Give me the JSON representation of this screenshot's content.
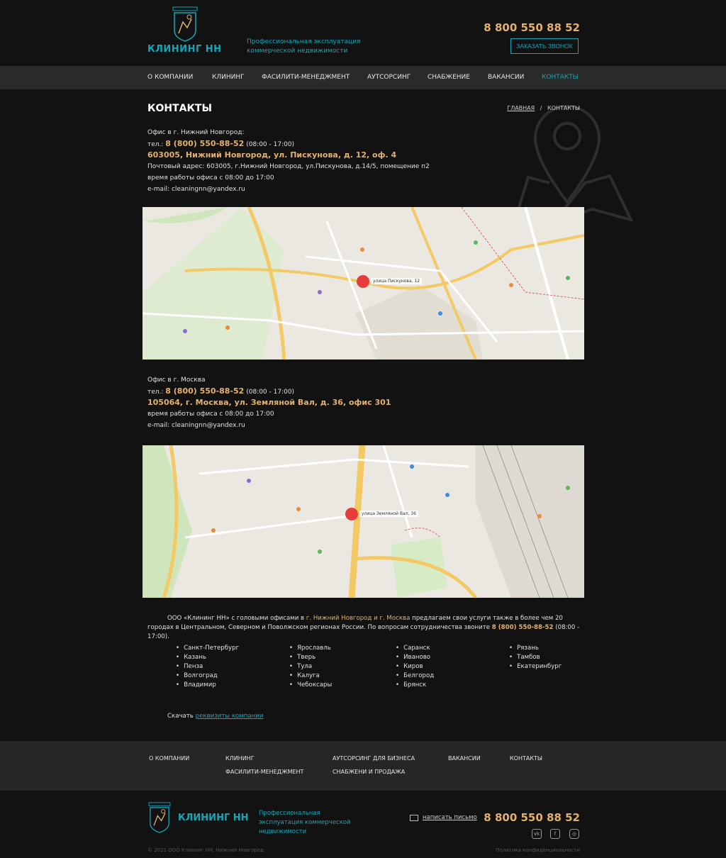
{
  "header": {
    "logo_text": "КЛИНИНГ НН",
    "tagline": "Профессиональная эксплуатация коммерческой недвижимости",
    "phone": "8 800 550 88 52",
    "call_button": "ЗАКАЗАТЬ ЗВОНОК"
  },
  "nav": {
    "items": [
      {
        "label": "О КОМПАНИИ"
      },
      {
        "label": "КЛИНИНГ"
      },
      {
        "label": "ФАСИЛИТИ-МЕНЕДЖМЕНТ"
      },
      {
        "label": "АУТСОРСИНГ"
      },
      {
        "label": "СНАБЖЕНИЕ"
      },
      {
        "label": "ВАКАНСИИ"
      },
      {
        "label": "КОНТАКТЫ",
        "active": true
      }
    ]
  },
  "page": {
    "title": "КОНТАКТЫ",
    "breadcrumb_home": "ГЛАВНАЯ",
    "breadcrumb_sep": "/",
    "breadcrumb_current": "КОНТАКТЫ"
  },
  "offices": [
    {
      "heading": "Офис в г. Нижний Новгород:",
      "phone_prefix": "тел.: ",
      "phone": "8 (800) 550-88-52",
      "hours_inline": " (08:00 - 17:00)",
      "address": "603005, Нижний Новгород, ул. Пискунова, д. 12, оф. 4",
      "postal": "Почтовый адрес: 603005, г.Нижний Новгород, ул.Пискунова, д.14/5, помещение п2",
      "work_hours": "время работы офиса с 08:00 до 17:00",
      "email": "e-mail: cleaningnn@yandex.ru",
      "map_label": "улица Пискунова, 12"
    },
    {
      "heading": "Офис в г. Москва",
      "phone_prefix": "тел.: ",
      "phone": "8 (800) 550-88-52",
      "hours_inline": " (08:00 - 17:00)",
      "address": "105064, г. Москва, ул. Земляной Вал, д. 36, офис 301",
      "work_hours": "время работы офиса с 08:00 до 17:00",
      "email": "e-mail: cleaningnn@yandex.ru",
      "map_label": "улица Земляной Вал, 36"
    }
  ],
  "description": {
    "part1": "ООО «Клининг НН» с головыми офисами в ",
    "city1": "г. Нижний Новгород",
    "and": " и ",
    "city2": "г. Москва",
    "part2": " предлагаем свои услуги также в более чем 20 городах в Центральном, Северном и Поволжском регионах России. По вопросам сотрудничества звоните ",
    "phone": "8 (800) 550-88-52",
    "part3": " (08:00 - 17:00)."
  },
  "cities": [
    [
      "Санкт-Петербург",
      "Казань",
      "Пенза",
      "Волгоград",
      "Владимир"
    ],
    [
      "Ярославль",
      "Тверь",
      "Тула",
      "Калуга",
      "Чебоксары"
    ],
    [
      "Саранск",
      "Иваново",
      "Киров",
      "Белгород",
      "Брянск"
    ],
    [
      "Рязань",
      "Тамбов",
      "Екатеринбург"
    ]
  ],
  "download": {
    "prefix": "Скачать ",
    "link": "реквизиты компании"
  },
  "footer_nav": {
    "about": "О КОМПАНИИ",
    "cleaning": "КЛИНИНГ",
    "facility": "ФАСИЛИТИ-МЕНЕДЖМЕНТ",
    "outsourcing": "АУТСОРСИНГ ДЛЯ БИЗНЕСА",
    "supply": "СНАБЖЕНИ И ПРОДАЖА",
    "vacancies": "ВАКАНСИИ",
    "contacts": "КОНТАКТЫ"
  },
  "footer": {
    "logo_text": "КЛИНИНГ НН",
    "tagline": "Профессиональная эксплуатация коммерческой недвижимости",
    "write_letter": "написать письмо",
    "phone": "8 800 550 88 52",
    "social": [
      "vk-icon",
      "facebook-icon",
      "instagram-icon"
    ],
    "copyright": "© 2021 ООО Клининг НН, Нижний Новгород",
    "privacy": "Политика конфиденциальности"
  },
  "colors": {
    "accent_teal": "#17a6b8",
    "accent_gold": "#e3b06e",
    "background": "#121212",
    "nav_bg": "#2a2a2a"
  }
}
